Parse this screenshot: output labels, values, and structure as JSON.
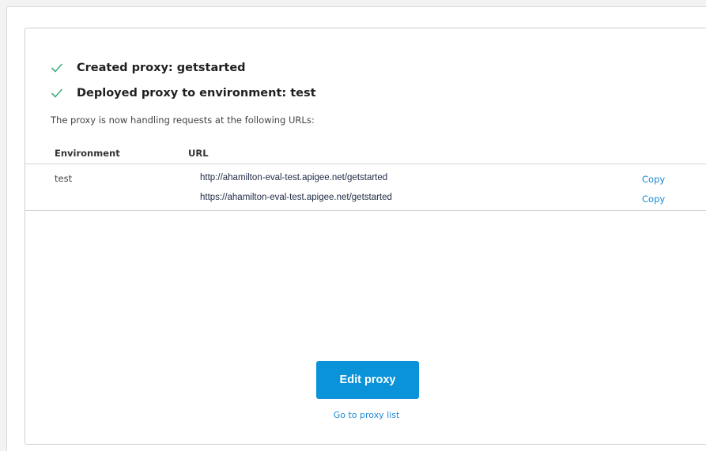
{
  "status": {
    "created_label": "Created proxy: getstarted",
    "deployed_label": "Deployed proxy to environment: test",
    "icon": "check-icon",
    "icon_color": "#3bb27f"
  },
  "intro_text": "The proxy is now handling requests at the following URLs:",
  "table": {
    "headers": {
      "environment": "Environment",
      "url": "URL"
    },
    "environment": "test",
    "rows": [
      {
        "url": "http://ahamilton-eval-test.apigee.net/getstarted",
        "action": "Copy"
      },
      {
        "url": "https://ahamilton-eval-test.apigee.net/getstarted",
        "action": "Copy"
      }
    ]
  },
  "actions": {
    "edit_proxy_label": "Edit proxy",
    "go_to_list_label": "Go to proxy list",
    "primary_color": "#0a93d8",
    "link_color": "#1a88d6"
  }
}
